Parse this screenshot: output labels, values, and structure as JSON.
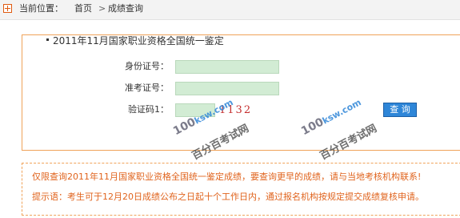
{
  "breadcrumb": {
    "prefix": "当前位置：",
    "home": "首页",
    "separator": ">",
    "current": "成绩查询"
  },
  "panel": {
    "title": "2011年11月国家职业资格全国统一鉴定"
  },
  "form": {
    "id_label": "身份证号：",
    "id_value": "",
    "admission_label": "准考证号：",
    "admission_value": "",
    "captcha_label": "验证码1：",
    "captcha_value": "",
    "captcha_code": "1132",
    "submit_label": "查 询"
  },
  "watermark": {
    "logo": "100",
    "logo_suffix": "ksw",
    "logo_domain": ".com",
    "text": "百分百考试网"
  },
  "notice": {
    "line1": "仅限查询2011年11月国家职业资格全国统一鉴定成绩，要查询更早的成绩，请与当地考核机构联系!",
    "line2": "提示语：考生可于12月20日成绩公布之日起十个工作日内，通过报名机构按规定提交成绩复核申请。"
  },
  "colors": {
    "accent_orange": "#e0641e",
    "border_orange": "#f0a35a",
    "input_green": "#d2ecd4",
    "button_blue": "#2e86d8",
    "captcha_red": "#c42d2d"
  }
}
